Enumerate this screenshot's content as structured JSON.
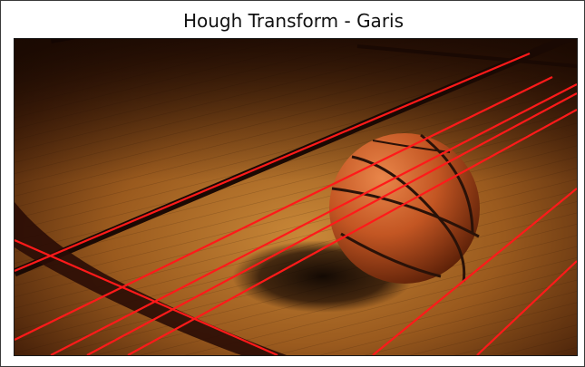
{
  "figure": {
    "title": "Hough Transform - Garis"
  },
  "image": {
    "subject": "basketball-on-hardwood-court",
    "overlay": "detected-lines",
    "line_color": "#ff0000"
  },
  "colors": {
    "floor_dark": "#2b1304",
    "floor_light": "#b8742c",
    "court_line": "#1c0a03",
    "ball_base": "#c45a25",
    "ball_seam": "#2a1208",
    "lines": "#ff1a1a"
  }
}
